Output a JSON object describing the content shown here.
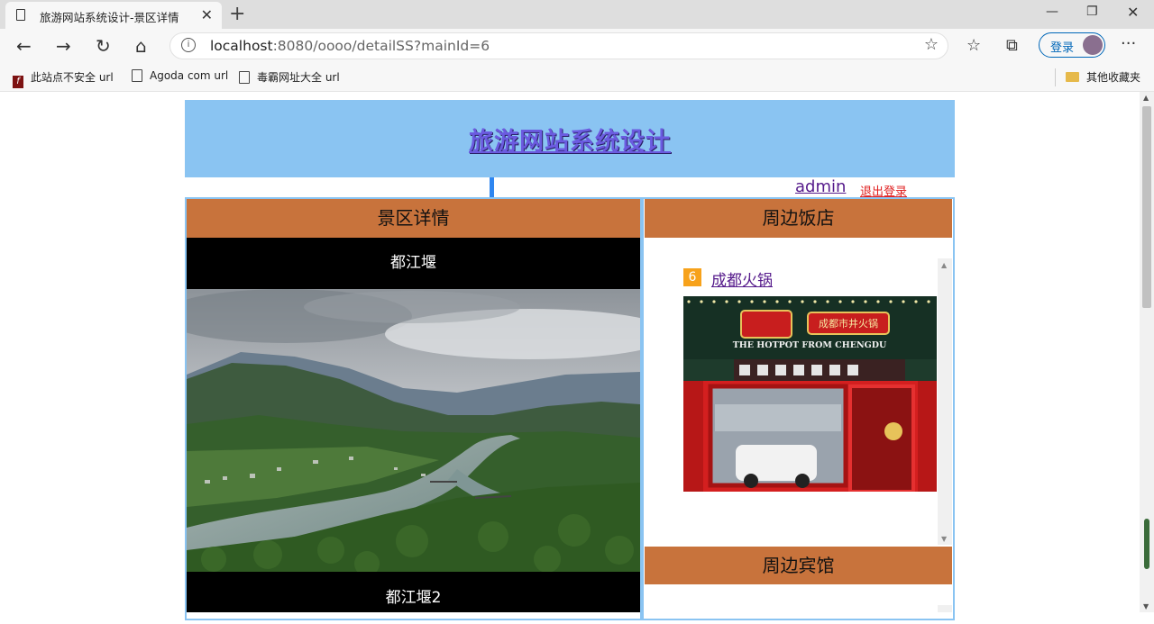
{
  "browser": {
    "tab_title": "旅游网站系统设计-景区详情",
    "url_host": "localhost",
    "url_rest": ":8080/oooo/detailSS?mainId=6",
    "login_label": "登录",
    "bookmarks": [
      {
        "label": "此站点不安全 url",
        "icon": "flash-icon"
      },
      {
        "label": "Agoda com url",
        "icon": "page-icon"
      },
      {
        "label": "毒霸网址大全 url",
        "icon": "page-icon"
      }
    ],
    "other_bookmarks": "其他收藏夹"
  },
  "site": {
    "title": "旅游网站系统设计",
    "user": "admin",
    "logout": "退出登录"
  },
  "detail": {
    "heading": "景区详情",
    "spot_name": "都江堰",
    "spot_name_2": "都江堰2"
  },
  "restaurants": {
    "heading": "周边饭店",
    "items": [
      {
        "rank": "6",
        "name": "成都火锅"
      }
    ],
    "photo_sign_cn": "成都市井火锅",
    "photo_sign_en": "THE HOTPOT FROM CHENGDU"
  },
  "hotels": {
    "heading": "周边宾馆"
  }
}
